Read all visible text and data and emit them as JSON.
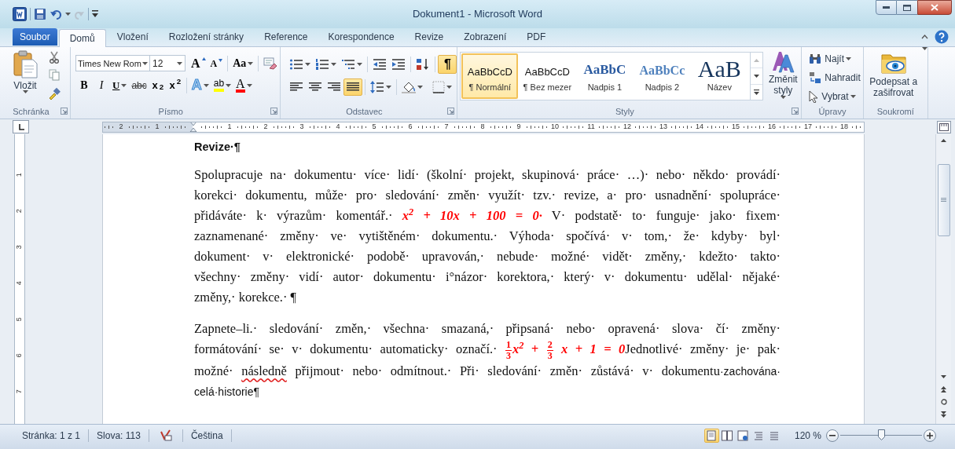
{
  "window": {
    "title": "Dokument1 - Microsoft Word"
  },
  "file_tab": {
    "label": "Soubor"
  },
  "tabs": [
    {
      "label": "Domů",
      "selected": true
    },
    {
      "label": "Vložení",
      "selected": false
    },
    {
      "label": "Rozložení stránky",
      "selected": false
    },
    {
      "label": "Reference",
      "selected": false
    },
    {
      "label": "Korespondence",
      "selected": false
    },
    {
      "label": "Revize",
      "selected": false
    },
    {
      "label": "Zobrazení",
      "selected": false
    },
    {
      "label": "PDF",
      "selected": false
    }
  ],
  "ribbon": {
    "clipboard": {
      "group_label": "Schránka",
      "paste_label": "Vložit"
    },
    "font": {
      "group_label": "Písmo",
      "name": "Times New Rom",
      "size": "12",
      "grow_glyph": "A",
      "shrink_glyph": "A",
      "case_glyph": "Aa",
      "buttons": [
        {
          "glyph": "B",
          "kind": "bold"
        },
        {
          "glyph": "I",
          "kind": "italic"
        },
        {
          "glyph": "U",
          "kind": "underline"
        },
        {
          "glyph": "abc",
          "kind": "strike"
        },
        {
          "glyph": "x$_{2}$",
          "kind": "sub"
        },
        {
          "glyph": "x$^{2}$",
          "kind": "sup"
        }
      ],
      "effect_buttons": [
        {
          "glyph": "A",
          "kind": "effects"
        },
        {
          "glyph": "ab",
          "kind": "highlight"
        },
        {
          "glyph": "A",
          "kind": "color"
        }
      ]
    },
    "paragraph": {
      "group_label": "Odstavec",
      "marks": {
        "glyph": "¶",
        "on": true
      },
      "alignments": [
        {
          "kind": "left",
          "selected": false
        },
        {
          "kind": "center",
          "selected": false
        },
        {
          "kind": "right",
          "selected": false
        },
        {
          "kind": "justify",
          "selected": true
        }
      ]
    },
    "styles": {
      "group_label": "Styly",
      "change_label": "Změnit styly",
      "items": [
        {
          "preview": "AaBbCcD",
          "label": "¶ Normální",
          "kind": "normal",
          "selected": true
        },
        {
          "preview": "AaBbCcD",
          "label": "¶ Bez mezer",
          "kind": "normal",
          "selected": false
        },
        {
          "preview": "AaBbC",
          "label": "Nadpis 1",
          "kind": "heading1",
          "selected": false
        },
        {
          "preview": "AaBbCc",
          "label": "Nadpis 2",
          "kind": "heading2",
          "selected": false
        },
        {
          "preview": "AaB",
          "label": "Název",
          "kind": "title",
          "selected": false
        }
      ]
    },
    "editing": {
      "group_label": "Úpravy",
      "find": "Najít",
      "replace": "Nahradit",
      "select": "Vybrat"
    },
    "privacy": {
      "group_label": "Soukromí",
      "sign_label": "Podepsat a zašifrovat"
    }
  },
  "ruler": {
    "left_labels": [
      "2",
      "1"
    ],
    "labels": [
      "1",
      "2",
      "3",
      "4",
      "5",
      "6",
      "7",
      "8",
      "9",
      "10",
      "11",
      "12",
      "13",
      "14",
      "15",
      "16",
      "17",
      "18"
    ]
  },
  "vertical_ruler": {
    "labels": [
      "1",
      "2",
      "3",
      "4",
      "5",
      "6",
      "7"
    ]
  },
  "document": {
    "heading": "Revize·¶",
    "paragraphs": [
      {
        "lines": [
          [
            {
              "kind": "serif",
              "text": "Spolupracuje na· dokumentu· více· lidí· (školní· projekt, skupinová· práce· …)· nebo· někdo· provádí·"
            }
          ],
          [
            {
              "kind": "serif",
              "text": "korekci· dokumentu, může· pro· sledování· změn· využít· tzv.· revize, a· pro· usnadnění· spolupráce·"
            }
          ],
          [
            {
              "kind": "serif",
              "text": "přidáváte· k· výrazům· komentář.· "
            },
            {
              "kind": "math",
              "text": "x$^{2}$ + 10x + 100 = 0·"
            },
            {
              "kind": "serif",
              "text": " V· podstatě· to· funguje· jako· fixem·"
            }
          ],
          [
            {
              "kind": "serif",
              "text": "zaznamenané· změny· ve· vytištěném· dokumentu.· Výhoda· spočívá· v· tom,· že· kdyby· byl·"
            }
          ],
          [
            {
              "kind": "serif",
              "text": "dokument· v· elektronické· podobě· upravován,· nebude· možné· vidět· změny,· kdežto· takto·"
            }
          ],
          [
            {
              "kind": "serif",
              "text": "všechny· změny· vidí· autor· dokumentu· i°názor· korektora,· který· v· dokumentu· udělal· nějaké·"
            }
          ],
          [
            {
              "kind": "serif",
              "text": "změny,· korekce.· ¶"
            }
          ]
        ]
      },
      {
        "lines": [
          [
            {
              "kind": "serif",
              "text": "Zapnete–li.· sledování· změn,· všechna· smazaná,· připsaná· nebo· opravená· slova· čí· změny·"
            }
          ],
          [
            {
              "kind": "serif",
              "text": "formátování· se· v· dokumentu· automaticky· označí.· "
            },
            {
              "kind": "fraction",
              "numerator": "1",
              "denominator": "3"
            },
            {
              "kind": "math",
              "text": "x$^{2}$ + "
            },
            {
              "kind": "fraction",
              "numerator": "2",
              "denominator": "3"
            },
            {
              "kind": "math",
              "text": " x + 1 = 0"
            },
            {
              "kind": "serif",
              "text": "Jednotlivé· změny· je· pak·"
            }
          ],
          [
            {
              "kind": "serif",
              "text": "možné· "
            },
            {
              "kind": "misspelled",
              "text": "následně"
            },
            {
              "kind": "serif",
              "text": " přijmout· nebo· odmítnout.· Při· sledování· změn· zůstává· v· dokumentu"
            },
            {
              "kind": "sans",
              "text": "·zachována·"
            }
          ],
          [
            {
              "kind": "sans",
              "text": "celá·historie¶"
            }
          ]
        ]
      }
    ]
  },
  "status_bar": {
    "page": "Stránka: 1 z 1",
    "words": "Slova: 113",
    "language": "Čeština",
    "view_buttons": [
      {
        "selected": true
      },
      {
        "selected": false
      },
      {
        "selected": false
      },
      {
        "selected": false
      },
      {
        "selected": false
      }
    ],
    "zoom_label": "120 %",
    "zoom": {
      "level": 0.5
    }
  }
}
